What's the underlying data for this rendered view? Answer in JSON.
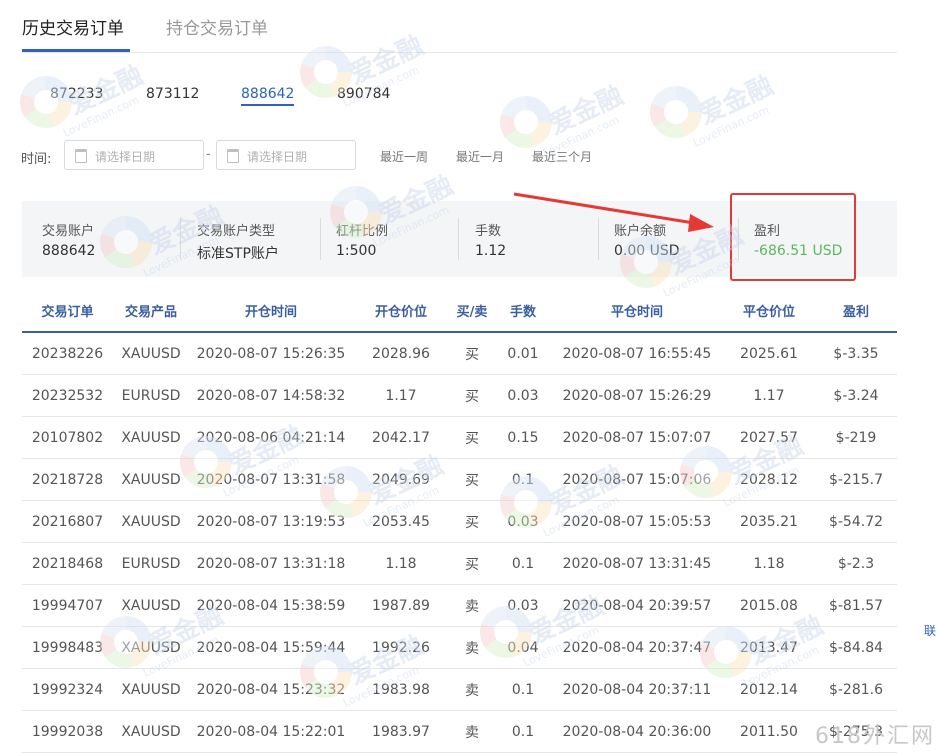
{
  "tabs": [
    {
      "label": "历史交易订单",
      "active": true
    },
    {
      "label": "持仓交易订单",
      "active": false
    }
  ],
  "accounts": [
    {
      "label": "872233",
      "active": false
    },
    {
      "label": "873112",
      "active": false
    },
    {
      "label": "888642",
      "active": true
    },
    {
      "label": "890784",
      "active": false
    }
  ],
  "filter": {
    "label": "时间:",
    "start_placeholder": "请选择日期",
    "end_placeholder": "请选择日期",
    "separator": "-",
    "quick": [
      "最近一周",
      "最近一月",
      "最近三个月"
    ]
  },
  "summary": [
    {
      "label": "交易账户",
      "value": "888642"
    },
    {
      "label": "交易账户类型",
      "value": "标准STP账户"
    },
    {
      "label": "杠杆比例",
      "value": "1:500"
    },
    {
      "label": "手数",
      "value": "1.12"
    },
    {
      "label": "账户余额",
      "value": "0.00 USD"
    },
    {
      "label": "盈利",
      "value": "-686.51 USD"
    }
  ],
  "table": {
    "columns": [
      "交易订单",
      "交易产品",
      "开仓时间",
      "开仓价位",
      "买/卖",
      "手数",
      "平仓时间",
      "平仓价位",
      "盈利"
    ],
    "rows": [
      [
        "20238226",
        "XAUUSD",
        "2020-08-07 15:26:35",
        "2028.96",
        "买",
        "0.01",
        "2020-08-07 16:55:45",
        "2025.61",
        "$-3.35"
      ],
      [
        "20232532",
        "EURUSD",
        "2020-08-07 14:58:32",
        "1.17",
        "买",
        "0.03",
        "2020-08-07 15:26:29",
        "1.17",
        "$-3.24"
      ],
      [
        "20107802",
        "XAUUSD",
        "2020-08-06 04:21:14",
        "2042.17",
        "买",
        "0.15",
        "2020-08-07 15:07:07",
        "2027.57",
        "$-219"
      ],
      [
        "20218728",
        "XAUUSD",
        "2020-08-07 13:31:58",
        "2049.69",
        "买",
        "0.1",
        "2020-08-07 15:07:06",
        "2028.12",
        "$-215.7"
      ],
      [
        "20216807",
        "XAUUSD",
        "2020-08-07 13:19:53",
        "2053.45",
        "买",
        "0.03",
        "2020-08-07 15:05:53",
        "2035.21",
        "$-54.72"
      ],
      [
        "20218468",
        "EURUSD",
        "2020-08-07 13:31:18",
        "1.18",
        "买",
        "0.1",
        "2020-08-07 13:31:45",
        "1.18",
        "$-2.3"
      ],
      [
        "19994707",
        "XAUUSD",
        "2020-08-04 15:38:59",
        "1987.89",
        "卖",
        "0.03",
        "2020-08-04 20:39:57",
        "2015.08",
        "$-81.57"
      ],
      [
        "19998483",
        "XAUUSD",
        "2020-08-04 15:59:44",
        "1992.26",
        "卖",
        "0.04",
        "2020-08-04 20:37:47",
        "2013.47",
        "$-84.84"
      ],
      [
        "19992324",
        "XAUUSD",
        "2020-08-04 15:23:32",
        "1983.98",
        "卖",
        "0.1",
        "2020-08-04 20:37:11",
        "2012.14",
        "$-281.6"
      ],
      [
        "19992038",
        "XAUUSD",
        "2020-08-04 15:22:01",
        "1983.97",
        "卖",
        "0.1",
        "2020-08-04 20:36:00",
        "2011.50",
        "$-275.3"
      ]
    ]
  },
  "watermark": {
    "brand": "爱金融",
    "sub": "LoveFinan.com"
  },
  "side_text": "联",
  "corner_watermark": "618外汇网",
  "colors": {
    "accent": "#2f62b8",
    "profit": "#5cb85c",
    "highlight": "#e53935"
  }
}
